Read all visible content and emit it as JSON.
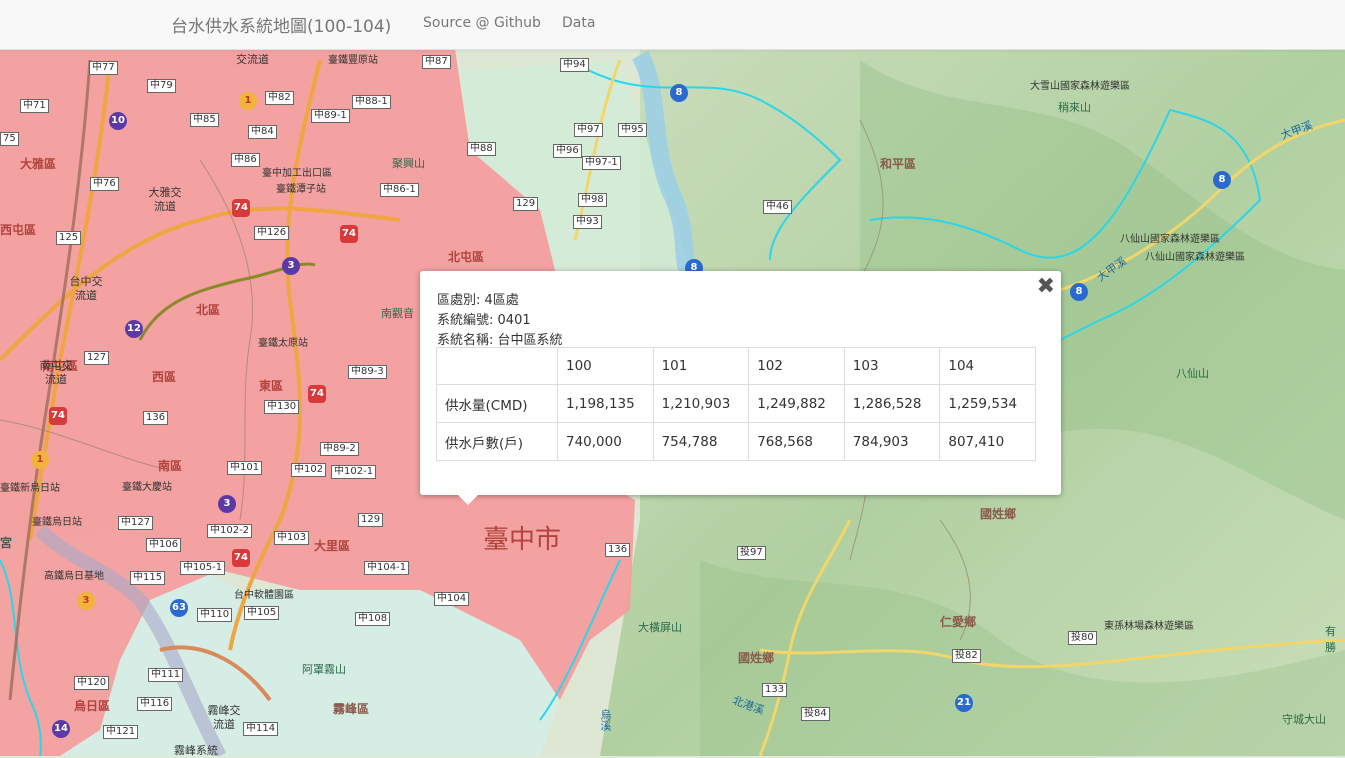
{
  "navbar": {
    "brand": "台水供水系統地圖(100-104)",
    "links": [
      "Source @ Github",
      "Data"
    ]
  },
  "popup": {
    "district_label": "區處別:",
    "district_value": "4區處",
    "system_no_label": "系統編號:",
    "system_no_value": "0401",
    "system_name_label": "系統名稱:",
    "system_name_value": "台中區系統",
    "close_icon": "close-icon",
    "table": {
      "years": [
        "100",
        "101",
        "102",
        "103",
        "104"
      ],
      "rows": [
        {
          "label": "供水量(CMD)",
          "values": [
            "1,198,135",
            "1,210,903",
            "1,249,882",
            "1,286,528",
            "1,259,534"
          ]
        },
        {
          "label": "供水戶數(戶)",
          "values": [
            "740,000",
            "754,788",
            "768,568",
            "784,903",
            "807,410"
          ]
        }
      ]
    }
  },
  "map": {
    "colors": {
      "supply_area": "#f4a0a0",
      "terrain_light": "#dbe8d2",
      "terrain_green": "#b9d6a5",
      "river": "#9fd3e8",
      "system_boundary": "#28d6e6",
      "road_yellow": "#f2d66b",
      "road_orange": "#f0a640",
      "admin_boundary": "#8a7a6a"
    },
    "big_label": "臺中市",
    "district_labels": [
      "大雅區",
      "北屯區",
      "和平區",
      "西屯區",
      "北區",
      "南屯區",
      "西區",
      "東區",
      "南區",
      "大里區",
      "烏日區",
      "霧峰區",
      "國姓鄉",
      "國姓鄉",
      "仁愛鄉",
      "宮"
    ],
    "place_labels": [
      "大雪山國家森林遊樂區",
      "稍來山",
      "聚興山",
      "南觀音",
      "八仙山國家森林遊樂區",
      "八仙山國家森林遊樂區",
      "八仙山",
      "大甲溪",
      "大甲溪",
      "臺中加工出口區",
      "臺鐵潭子站",
      "臺鐵豐原站",
      "交流道",
      "大雅交流道",
      "台中交流道",
      "南屯交流道",
      "臺鐵太原站",
      "臺鐵大慶站",
      "臺鐵新烏日站",
      "臺鐵烏日站",
      "高鐵烏日基地",
      "台中軟體園區",
      "阿罩霧山",
      "霧峰交流道",
      "霧峰系統",
      "大橫屏山",
      "北港溪",
      "東孫林場森林遊樂區",
      "守城大山",
      "有勝",
      "烏溪"
    ],
    "road_labels": [
      "中77",
      "中79",
      "中71",
      "中87",
      "中94",
      "中85",
      "中84",
      "中82",
      "中88-1",
      "中89-1",
      "中86",
      "中86-1",
      "中76",
      "中126",
      "中88",
      "中97",
      "中95",
      "中96",
      "中97-1",
      "中98",
      "中93",
      "中46",
      "129",
      "125",
      "127",
      "136",
      "中130",
      "中89-3",
      "中89-2",
      "中101",
      "中102",
      "中102-1",
      "中127",
      "中102-2",
      "中106",
      "中103",
      "129",
      "中105-1",
      "中104-1",
      "中104",
      "中115",
      "中110",
      "中105",
      "中108",
      "中111",
      "中116",
      "中120",
      "中121",
      "中114",
      "136",
      "投97",
      "投82",
      "133",
      "投84",
      "投80",
      "75"
    ],
    "highway_badges": [
      "10",
      "1",
      "74",
      "74",
      "3",
      "12",
      "74",
      "74",
      "3",
      "1",
      "74",
      "63",
      "3",
      "14",
      "8",
      "8",
      "8",
      "8",
      "21"
    ]
  }
}
